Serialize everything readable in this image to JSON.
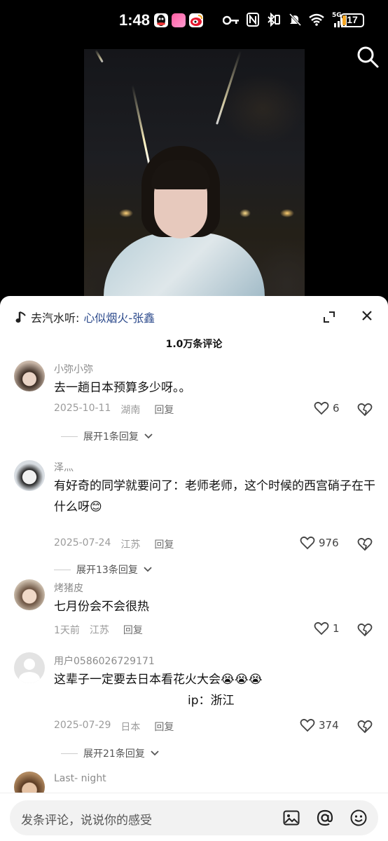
{
  "status_bar": {
    "time": "1:48",
    "network": "5G",
    "battery": "17",
    "battery_level_percent": 17
  },
  "video": {
    "description_icons": [
      "search-icon"
    ]
  },
  "sheet": {
    "music_prefix": "去汽水听:",
    "music_song": "心似烟火-张鑫",
    "comment_count": "1.0万条评论"
  },
  "comments": [
    {
      "user": "小弥小弥",
      "text": "去一趟日本预算多少呀。。",
      "date": "2025-10-11",
      "location": "湖南",
      "reply": "回复",
      "likes": "6",
      "expand": "展开1条回复"
    },
    {
      "user": "泽灬",
      "text": "有好奇的同学就要问了：老师老师，这个时候的西宫硝子在干什么呀😊",
      "date": "2025-07-24",
      "location": "江苏",
      "reply": "回复",
      "likes": "976",
      "expand": "展开13条回复"
    },
    {
      "user": "烤猪皮",
      "text": "七月份会不会很热",
      "date": "1天前",
      "location": "江苏",
      "reply": "回复",
      "likes": "1"
    },
    {
      "user": "用户0586026729171",
      "text": "这辈子一定要去日本看花火大会😭😭😭",
      "ip_line": "ip：浙江",
      "date": "2025-07-29",
      "location": "日本",
      "reply": "回复",
      "likes": "374",
      "expand": "展开21条回复"
    },
    {
      "user": "Last- night"
    }
  ],
  "input": {
    "placeholder": "发条评论，说说你的感受"
  }
}
